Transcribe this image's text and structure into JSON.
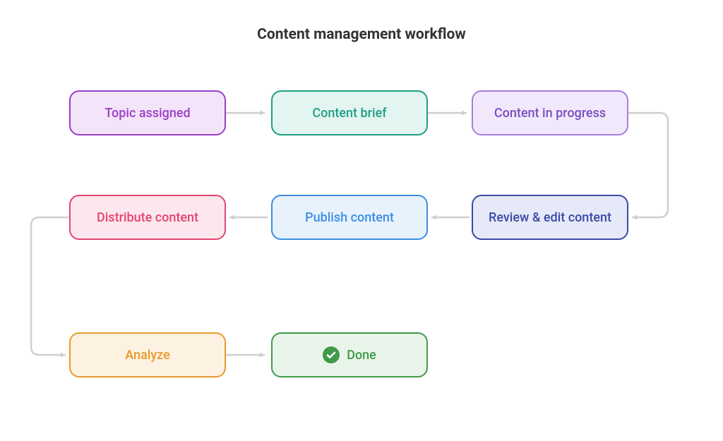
{
  "title": "Content management workflow",
  "arrow_color": "#cfcfcf",
  "nodes": {
    "topic_assigned": {
      "label": "Topic assigned",
      "border": "#9b3fc6",
      "fill": "#f3e4fa",
      "text": "#9b3fc6"
    },
    "content_brief": {
      "label": "Content brief",
      "border": "#1e9e84",
      "fill": "#e3f5f0",
      "text": "#1e9e84"
    },
    "content_in_progress": {
      "label": "Content in progress",
      "border": "#a77ee0",
      "fill": "#f1e9fb",
      "text": "#7a4fc1"
    },
    "review_edit": {
      "label": "Review & edit content",
      "border": "#3a4aa8",
      "fill": "#e6e9f7",
      "text": "#3a4aa8"
    },
    "publish": {
      "label": "Publish content",
      "border": "#3b8fe3",
      "fill": "#e8f2fc",
      "text": "#3b8fe3"
    },
    "distribute": {
      "label": "Distribute content",
      "border": "#e4456f",
      "fill": "#fde7ee",
      "text": "#e4456f"
    },
    "analyze": {
      "label": "Analyze",
      "border": "#e89a2a",
      "fill": "#fdf2e2",
      "text": "#e89a2a"
    },
    "done": {
      "label": "Done",
      "border": "#3f9a4a",
      "fill": "#e9f5ea",
      "text": "#3f9a4a",
      "check_bg": "#3f9a4a",
      "check_fg": "#ffffff"
    }
  },
  "connections": [
    {
      "from": "topic_assigned",
      "to": "content_brief"
    },
    {
      "from": "content_brief",
      "to": "content_in_progress"
    },
    {
      "from": "content_in_progress",
      "to": "review_edit"
    },
    {
      "from": "review_edit",
      "to": "publish"
    },
    {
      "from": "publish",
      "to": "distribute"
    },
    {
      "from": "distribute",
      "to": "analyze"
    },
    {
      "from": "analyze",
      "to": "done"
    }
  ]
}
